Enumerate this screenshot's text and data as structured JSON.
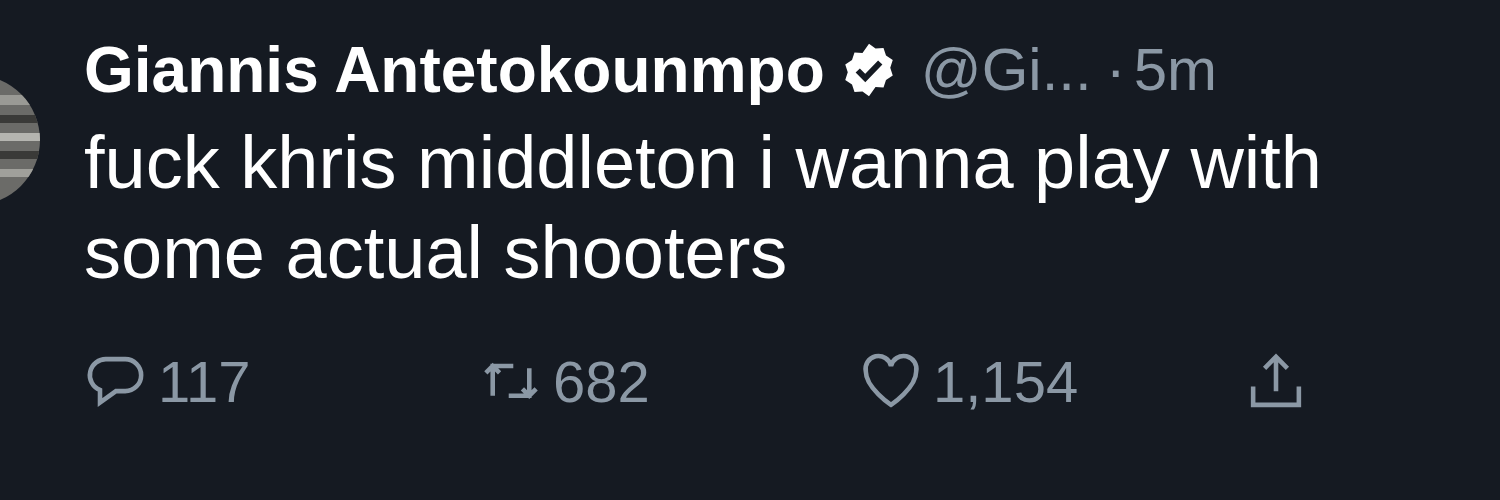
{
  "tweet": {
    "author": {
      "name": "Giannis Antetokounmpo",
      "verified": true,
      "handle": "@Gi...",
      "separator": "·",
      "time": "5m"
    },
    "text": "fuck khris middleton i wanna play with some actual shooters",
    "actions": [
      {
        "kind": "reply",
        "count": "117"
      },
      {
        "kind": "retweet",
        "count": "682"
      },
      {
        "kind": "like",
        "count": "1,154"
      },
      {
        "kind": "share"
      }
    ]
  }
}
